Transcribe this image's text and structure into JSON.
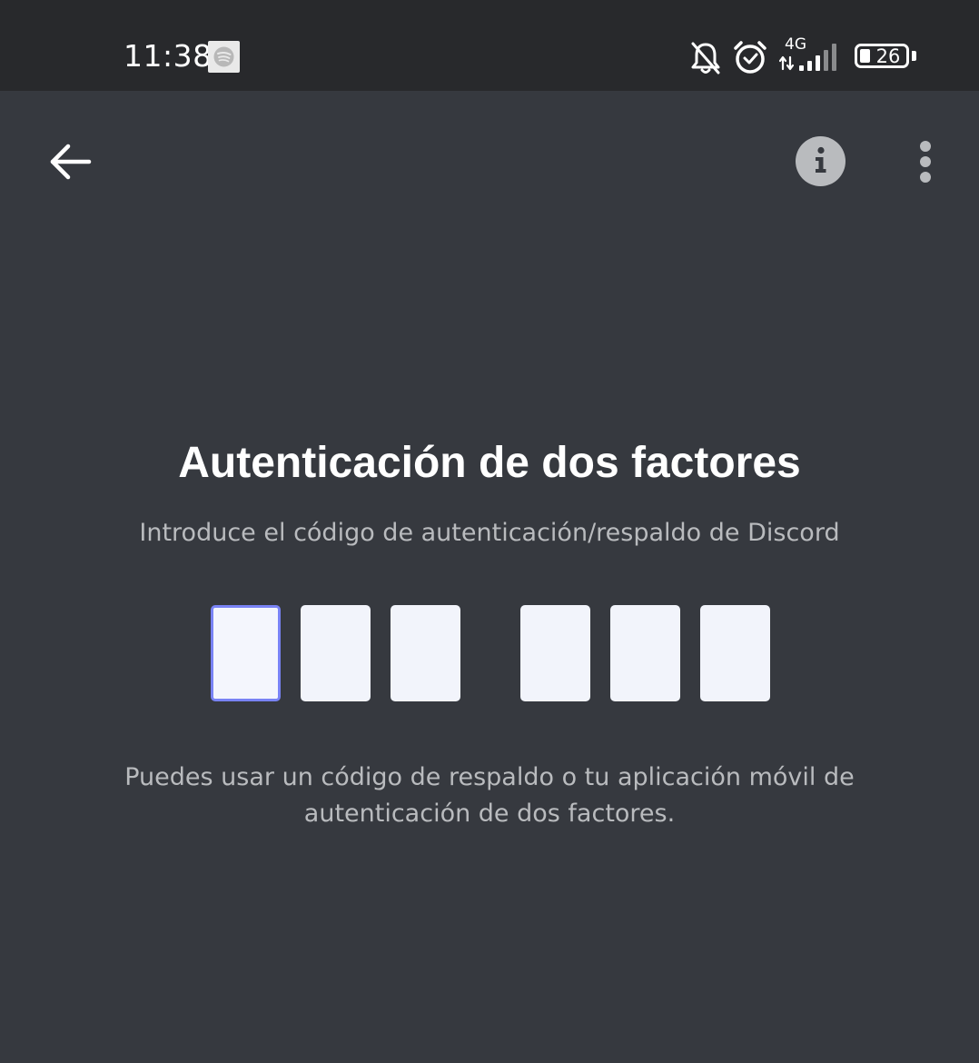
{
  "status_bar": {
    "time": "11:38",
    "network": "4G",
    "battery_level": "26",
    "icons": [
      "spotify-icon",
      "bell-muted-icon",
      "alarm-icon",
      "network-arrows-icon",
      "signal-icon",
      "battery-icon"
    ]
  },
  "header": {
    "icons": [
      "back-arrow-icon",
      "info-icon",
      "more-vertical-icon"
    ]
  },
  "main": {
    "title": "Autenticación de dos factores",
    "subtitle": "Introduce el código de autenticación/respaldo de Discord",
    "code_inputs": [
      "",
      "",
      "",
      "",
      "",
      ""
    ],
    "focused_input_index": 0,
    "help_line_1": "Puedes usar un código de respaldo o tu aplicación móvil de",
    "help_line_2": "autenticación de dos factores."
  },
  "colors": {
    "background": "#36393f",
    "status_bar": "#28292c",
    "title": "#ffffff",
    "muted_text": "#b9bbbe",
    "input_background": "#f2f4fb",
    "focus_accent": "#7983f5"
  }
}
